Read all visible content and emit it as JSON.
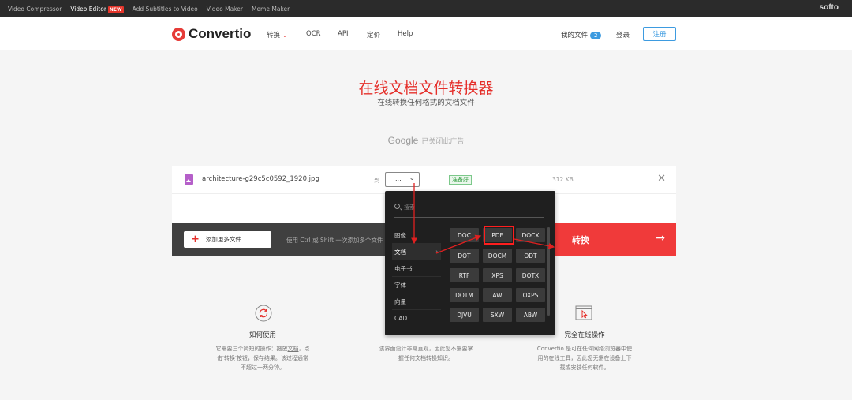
{
  "topbar": {
    "links": [
      "Video Compressor",
      "Video Editor",
      "Add Subtitles to Video",
      "Video Maker",
      "Meme Maker"
    ],
    "new_badge": "NEW",
    "brand": "softo"
  },
  "header": {
    "logo": "Convertio",
    "nav": [
      "转换",
      "OCR",
      "API",
      "定价",
      "Help"
    ],
    "my_files": "我的文件",
    "my_files_count": "2",
    "login": "登录",
    "signup": "注册"
  },
  "hero": {
    "title": "在线文档文件转换器",
    "subtitle": "在线转换任何格式的文档文件"
  },
  "ad": {
    "google": "Google",
    "text": "已关闭此广告"
  },
  "file": {
    "name": "architecture-g29c5c0592_1920.jpg",
    "to_label": "到",
    "select_value": "...",
    "status": "准备好",
    "size": "312 KB"
  },
  "actions": {
    "add_files": "添加更多文件",
    "hint": "使用 Ctrl 或 Shift 一次添加多个文件",
    "convert": "转换"
  },
  "dropdown": {
    "search_placeholder": "搜索",
    "categories": [
      "图像",
      "文档",
      "电子书",
      "字体",
      "向量",
      "CAD"
    ],
    "formats": [
      [
        "DOC",
        "PDF",
        "DOCX"
      ],
      [
        "DOT",
        "DOCM",
        "ODT"
      ],
      [
        "RTF",
        "XPS",
        "DOTX"
      ],
      [
        "DOTM",
        "AW",
        "OXPS"
      ],
      [
        "DJVU",
        "SXW",
        "ABW"
      ]
    ]
  },
  "features": [
    {
      "title": "如何使用",
      "desc_lines": [
        "它需要三个简短的操作：拖放文档，点",
        "击'转换'按钮，保存结果。该过程通常",
        "不超过一两分钟。"
      ],
      "underline_word": "文档"
    },
    {
      "title": "",
      "desc_lines": [
        "该界面设计非常直观，因此您不需要掌",
        "握任何文档转换知识。"
      ]
    },
    {
      "title": "完全在线操作",
      "desc_lines": [
        "Convertio 是可在任何网络浏览器中使",
        "用的在线工具，因此您无需在设备上下",
        "载或安装任何软件。"
      ]
    }
  ],
  "colors": {
    "accent_red": "#e5302b",
    "convert_red": "#f03a3a",
    "blue": "#3d9be0",
    "dropdown_bg": "#1f1f1f"
  }
}
